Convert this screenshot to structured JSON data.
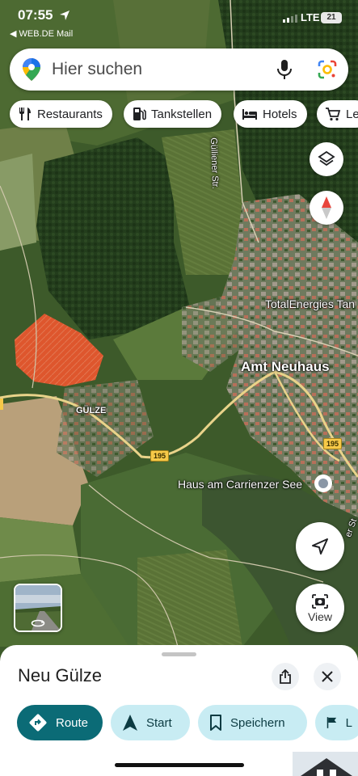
{
  "status_bar": {
    "time": "07:55",
    "back_label": "◀ WEB.DE Mail",
    "network": "LTE",
    "battery": "21"
  },
  "search": {
    "placeholder": "Hier suchen",
    "icons": [
      "maps-pin-logo-icon",
      "microphone-icon",
      "google-lens-icon"
    ]
  },
  "chips": [
    {
      "label": "Restaurants",
      "icon": "fork-knife-icon"
    },
    {
      "label": "Tankstellen",
      "icon": "fuel-pump-icon"
    },
    {
      "label": "Hotels",
      "icon": "bed-icon"
    },
    {
      "label": "Le",
      "icon": "shopping-cart-icon"
    }
  ],
  "map": {
    "labels": {
      "street_vertical": "Gülliener Str.",
      "poi_total": "TotalEnergies Tan",
      "town": "Amt Neuhaus",
      "village": "GÜLZE",
      "place": "Haus am Carrienzer See",
      "street_right": "er St"
    },
    "road_numbers": [
      "195",
      "195"
    ],
    "colors": {
      "field_highlight": "#f0552d",
      "road": "#e9d38a"
    }
  },
  "map_controls": {
    "view_label": "View",
    "icons": [
      "layers-icon",
      "compass-icon",
      "my-location-icon",
      "street-view-camera-icon"
    ]
  },
  "sheet": {
    "title": "Neu Gülze",
    "actions": [
      {
        "label": "Route",
        "icon": "directions-icon",
        "style": "primary"
      },
      {
        "label": "Start",
        "icon": "navigation-arrow-icon",
        "style": "secondary"
      },
      {
        "label": "Speichern",
        "icon": "bookmark-icon",
        "style": "secondary"
      },
      {
        "label": "L",
        "icon": "flag-icon",
        "style": "secondary"
      }
    ],
    "colors": {
      "primary": "#0b6b76",
      "secondary": "#c8ecf3"
    }
  }
}
